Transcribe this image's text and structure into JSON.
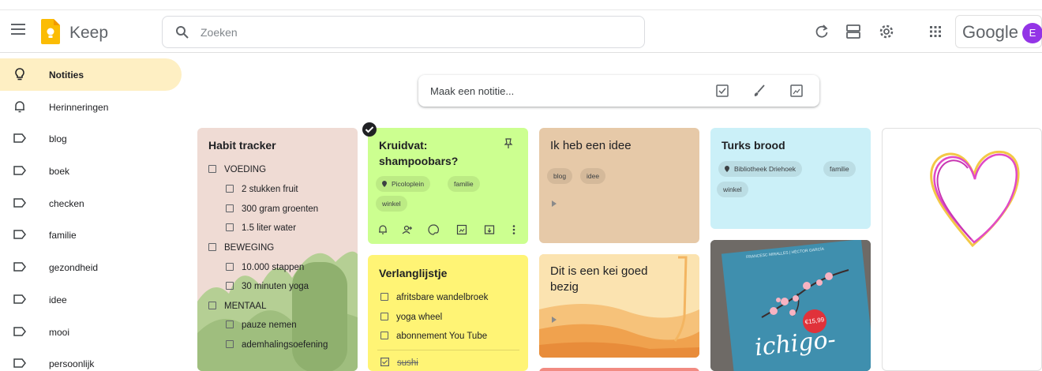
{
  "header": {
    "app_name": "Keep",
    "search_placeholder": "Zoeken",
    "account_brand": "Google",
    "avatar_letter": "E",
    "brand_color": "#fbbc04",
    "avatar_color": "#9334e6"
  },
  "sidebar": {
    "items": [
      {
        "label": "Notities",
        "icon": "lightbulb-icon",
        "active": true
      },
      {
        "label": "Herinneringen",
        "icon": "bell-icon"
      },
      {
        "label": "blog",
        "icon": "label-icon"
      },
      {
        "label": "boek",
        "icon": "label-icon"
      },
      {
        "label": "checken",
        "icon": "label-icon"
      },
      {
        "label": "familie",
        "icon": "label-icon"
      },
      {
        "label": "gezondheid",
        "icon": "label-icon"
      },
      {
        "label": "idee",
        "icon": "label-icon"
      },
      {
        "label": "mooi",
        "icon": "label-icon"
      },
      {
        "label": "persoonlijk",
        "icon": "label-icon"
      }
    ]
  },
  "take_note": {
    "placeholder": "Maak een notitie..."
  },
  "notes": {
    "habit": {
      "title": "Habit tracker",
      "color": "#efdbd4",
      "items": [
        {
          "text": "VOEDING",
          "level": 0
        },
        {
          "text": "2 stukken fruit",
          "level": 1
        },
        {
          "text": "300 gram groenten",
          "level": 1
        },
        {
          "text": "1.5 liter water",
          "level": 1
        },
        {
          "text": "BEWEGING",
          "level": 0
        },
        {
          "text": "10.000 stappen",
          "level": 1
        },
        {
          "text": "30 minuten yoga",
          "level": 1
        },
        {
          "text": "MENTAAL",
          "level": 0
        },
        {
          "text": "pauze nemen",
          "level": 1
        },
        {
          "text": "ademhalingsoefening",
          "level": 1
        }
      ]
    },
    "kruidvat": {
      "title_line1": "Kruidvat:",
      "title_line2": "shampoobars?",
      "color": "#ccff90",
      "chips": [
        "Picoloplein",
        "familie",
        "winkel"
      ]
    },
    "idee": {
      "title": "Ik heb een idee",
      "color": "#e6c9a8",
      "chips": [
        "blog",
        "idee"
      ]
    },
    "turks": {
      "title": "Turks brood",
      "color": "#cbf0f8",
      "chips": [
        "Bibliotheek Driehoek",
        "familie",
        "winkel"
      ]
    },
    "verlang": {
      "title": "Verlanglijstje",
      "color": "#fff475",
      "items": [
        "afritsbare wandelbroek",
        "yoga wheel",
        "abonnement You Tube"
      ],
      "checked_items": [
        "sushi"
      ]
    },
    "kei": {
      "title_line1": "Dit is een kei goed",
      "title_line2": "bezig"
    },
    "book": {
      "authors": "FRANCESC MIRALLES | HÉCTOR GARCÍA",
      "price": "€15,99",
      "cover_title": "ichigo-"
    }
  }
}
